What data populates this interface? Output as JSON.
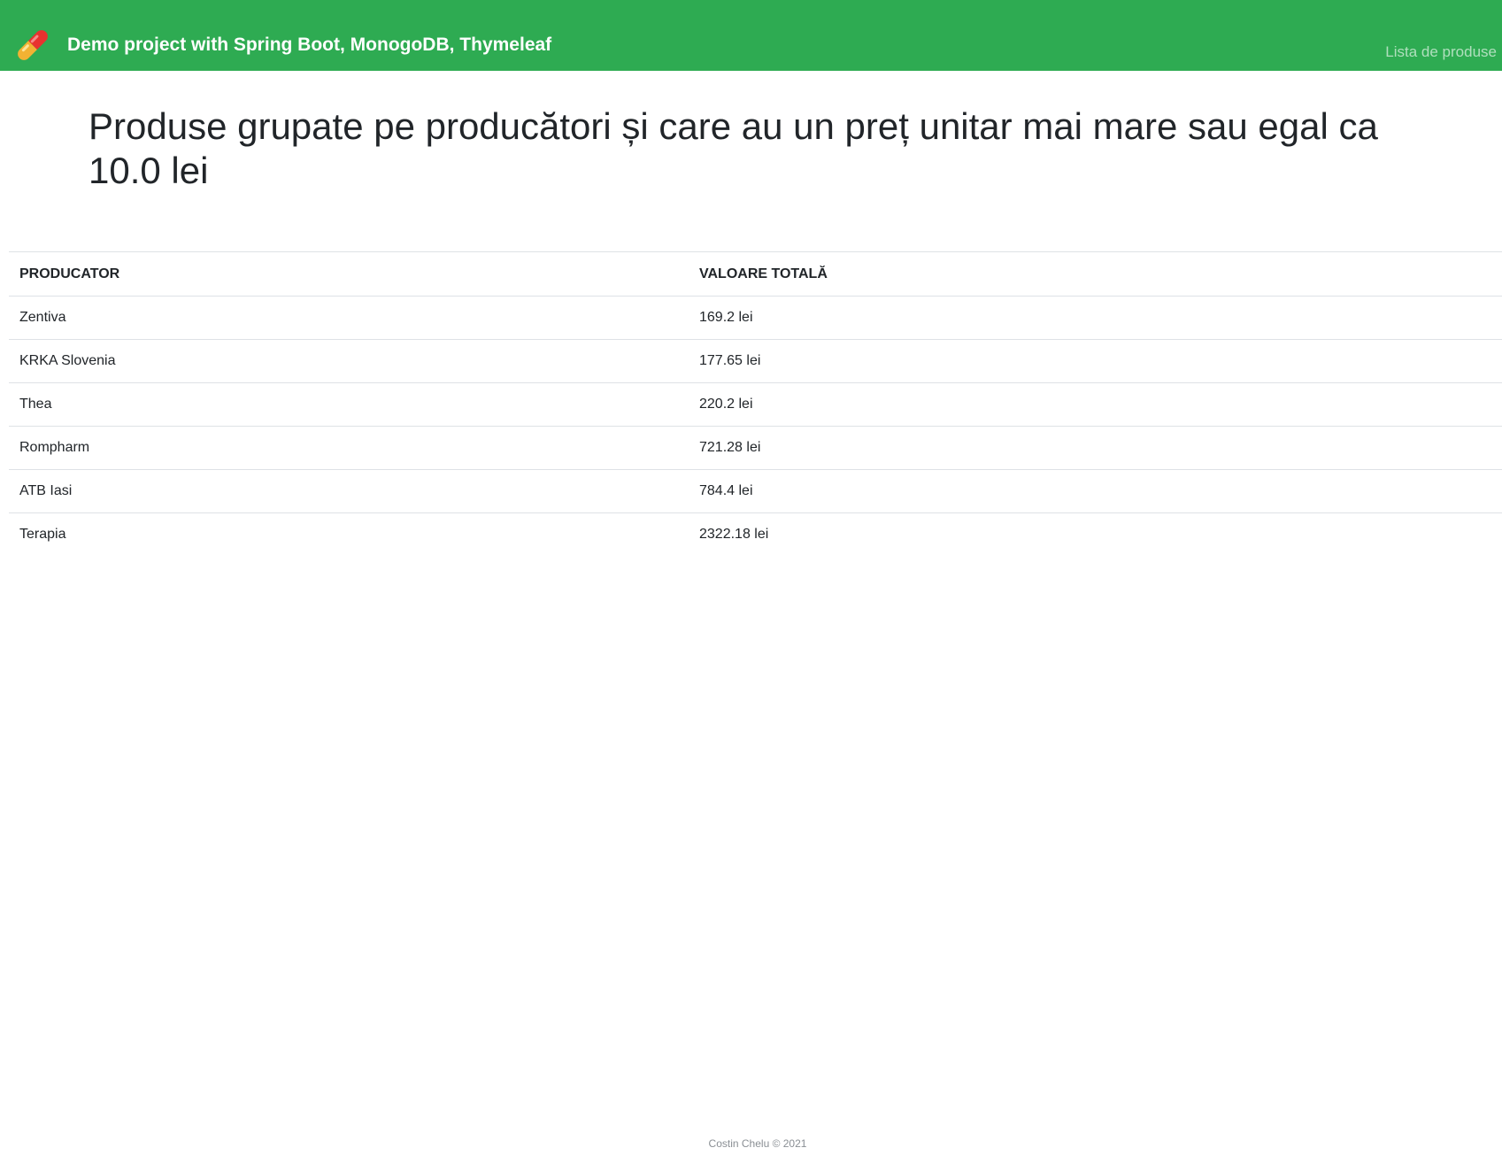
{
  "navbar": {
    "brand_icon": "pill-icon",
    "brand_title": "Demo project with Spring Boot, MonogoDB, Thymeleaf",
    "link_label": "Lista de produse",
    "background_color": "#2eab52"
  },
  "main": {
    "title": "Produse grupate pe producători și care au un preț unitar mai mare sau egal ca 10.0 lei"
  },
  "table": {
    "headers": [
      "PRODUCATOR",
      "VALOARE TOTALĂ"
    ],
    "rows": [
      {
        "producer": "Zentiva",
        "total": "169.2 lei"
      },
      {
        "producer": "KRKA Slovenia",
        "total": "177.65 lei"
      },
      {
        "producer": "Thea",
        "total": "220.2 lei"
      },
      {
        "producer": "Rompharm",
        "total": "721.28 lei"
      },
      {
        "producer": "ATB Iasi",
        "total": "784.4 lei"
      },
      {
        "producer": "Terapia",
        "total": "2322.18 lei"
      }
    ]
  },
  "footer": {
    "text": "Costin Chelu © 2021"
  }
}
